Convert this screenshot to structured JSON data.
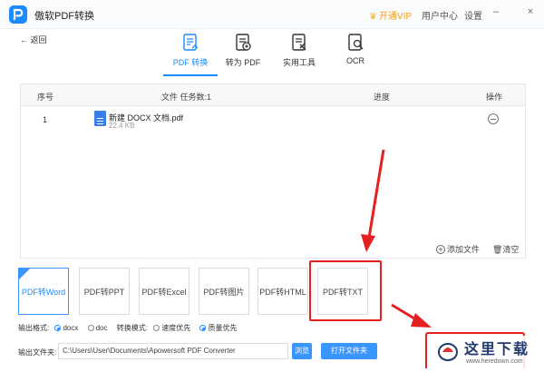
{
  "app": {
    "title": "傲软PDF转换",
    "vip_label": "开通VIP",
    "user_center": "用户中心",
    "settings": "设置"
  },
  "window_controls": {
    "minimize": "–",
    "close": "×"
  },
  "back": {
    "label": "返回"
  },
  "nav": {
    "items": [
      {
        "label": "PDF 转换",
        "icon": "pdf-convert-icon",
        "active": true
      },
      {
        "label": "转为 PDF",
        "icon": "to-pdf-icon",
        "active": false
      },
      {
        "label": "实用工具",
        "icon": "tools-icon",
        "active": false
      },
      {
        "label": "OCR",
        "icon": "ocr-icon",
        "active": false
      }
    ]
  },
  "table": {
    "headers": {
      "no": "序号",
      "file": "文件 任务数:1",
      "progress": "进度",
      "action": "操作"
    },
    "rows": [
      {
        "no": "1",
        "name": "新建 DOCX 文档.pdf",
        "size": "22.4 KB"
      }
    ],
    "add_file": "添加文件",
    "clear": "清空"
  },
  "formats": [
    {
      "label": "PDF转Word",
      "selected": true
    },
    {
      "label": "PDF转PPT",
      "selected": false
    },
    {
      "label": "PDF转Excel",
      "selected": false
    },
    {
      "label": "PDF转图片",
      "selected": false
    },
    {
      "label": "PDF转HTML",
      "selected": false
    },
    {
      "label": "PDF转TXT",
      "selected": false
    }
  ],
  "options": {
    "output_format_label": "输出格式:",
    "docx": "docx",
    "doc": "doc",
    "mode_label": "转换模式:",
    "speed": "速度优先",
    "quality": "质量优先"
  },
  "output": {
    "label": "输出文件夹:",
    "path": "C:\\Users\\User\\Documents\\Apowersoft PDF Converter",
    "browse": "浏览",
    "open": "打开文件夹"
  },
  "watermark": {
    "text": "这里下载",
    "url": "www.heredown.com"
  },
  "colors": {
    "accent": "#1a8cff",
    "annotation": "#e52020",
    "vip": "#f0a020"
  }
}
